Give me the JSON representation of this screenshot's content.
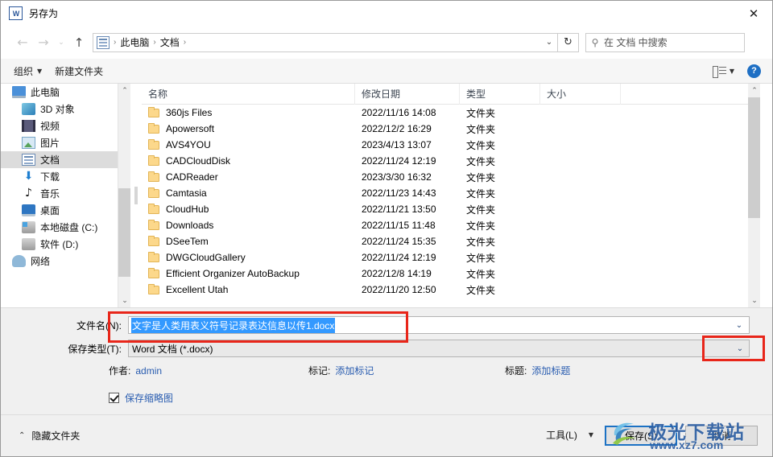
{
  "window": {
    "title": "另存为",
    "app_icon": "W",
    "close_label": "✕"
  },
  "navbar": {
    "back_icon": "←",
    "forward_icon": "→",
    "recent_icon": "⌄",
    "up_icon": "↑",
    "breadcrumbs": [
      "此电脑",
      "文档"
    ],
    "separator": "›",
    "dropdown_icon": "⌄",
    "refresh_icon": "↻",
    "search_icon": "🔍",
    "search_placeholder": "在 文档 中搜索"
  },
  "toolbar": {
    "organize_label": "组织",
    "organize_caret": "▼",
    "new_folder_label": "新建文件夹",
    "view_caret": "▼",
    "help_label": "?"
  },
  "sidebar": {
    "items": [
      {
        "label": "此电脑",
        "icon": "pc-icon",
        "cls": "ic-pc",
        "root": true,
        "selected": false
      },
      {
        "label": "3D 对象",
        "icon": "3d-objects-icon",
        "cls": "ic-3d",
        "root": false,
        "selected": false
      },
      {
        "label": "视频",
        "icon": "videos-icon",
        "cls": "ic-video",
        "root": false,
        "selected": false
      },
      {
        "label": "图片",
        "icon": "pictures-icon",
        "cls": "ic-pic",
        "root": false,
        "selected": false
      },
      {
        "label": "文档",
        "icon": "documents-icon",
        "cls": "ic-doc",
        "root": false,
        "selected": true
      },
      {
        "label": "下载",
        "icon": "downloads-icon",
        "cls": "ic-dl",
        "glyph": "⬇",
        "root": false,
        "selected": false
      },
      {
        "label": "音乐",
        "icon": "music-icon",
        "cls": "ic-music",
        "glyph": "♪",
        "root": false,
        "selected": false
      },
      {
        "label": "桌面",
        "icon": "desktop-icon",
        "cls": "ic-desk",
        "root": false,
        "selected": false
      },
      {
        "label": "本地磁盘 (C:)",
        "icon": "local-disk-c-icon",
        "cls": "ic-drive sys",
        "root": false,
        "selected": false
      },
      {
        "label": "软件 (D:)",
        "icon": "drive-d-icon",
        "cls": "ic-drive",
        "root": false,
        "selected": false
      },
      {
        "label": "网络",
        "icon": "network-icon",
        "cls": "ic-net",
        "root": true,
        "selected": false
      }
    ],
    "scroll_up_icon": "⌃",
    "scroll_down_icon": "⌄"
  },
  "filelist": {
    "columns": [
      "名称",
      "修改日期",
      "类型",
      "大小"
    ],
    "rows": [
      {
        "name": "360js Files",
        "date": "2022/11/16 14:08",
        "type": "文件夹",
        "size": ""
      },
      {
        "name": "Apowersoft",
        "date": "2022/12/2 16:29",
        "type": "文件夹",
        "size": ""
      },
      {
        "name": "AVS4YOU",
        "date": "2023/4/13 13:07",
        "type": "文件夹",
        "size": ""
      },
      {
        "name": "CADCloudDisk",
        "date": "2022/11/24 12:19",
        "type": "文件夹",
        "size": ""
      },
      {
        "name": "CADReader",
        "date": "2023/3/30 16:32",
        "type": "文件夹",
        "size": ""
      },
      {
        "name": "Camtasia",
        "date": "2022/11/23 14:43",
        "type": "文件夹",
        "size": ""
      },
      {
        "name": "CloudHub",
        "date": "2022/11/21 13:50",
        "type": "文件夹",
        "size": ""
      },
      {
        "name": "Downloads",
        "date": "2022/11/15 11:48",
        "type": "文件夹",
        "size": ""
      },
      {
        "name": "DSeeTem",
        "date": "2022/11/24 15:35",
        "type": "文件夹",
        "size": ""
      },
      {
        "name": "DWGCloudGallery",
        "date": "2022/11/24 12:19",
        "type": "文件夹",
        "size": ""
      },
      {
        "name": "Efficient Organizer AutoBackup",
        "date": "2022/12/8 14:19",
        "type": "文件夹",
        "size": ""
      },
      {
        "name": "Excellent Utah",
        "date": "2022/11/20 12:50",
        "type": "文件夹",
        "size": ""
      }
    ],
    "scroll_up_icon": "⌃",
    "scroll_down_icon": "⌄"
  },
  "form": {
    "filename_label": "文件名(N):",
    "filename_value": "文字是人类用表义符号记录表达信息以传1.docx",
    "filename_caret": "⌄",
    "savetype_label": "保存类型(T):",
    "savetype_value": "Word 文档 (*.docx)",
    "savetype_caret": "⌄",
    "author_key": "作者:",
    "author_value": "admin",
    "tags_key": "标记:",
    "tags_value": "添加标记",
    "title_key": "标题:",
    "title_value": "添加标题",
    "thumbnail_label": "保存缩略图",
    "thumbnail_checked": true
  },
  "footer": {
    "hide_folders_label": "隐藏文件夹",
    "hide_folders_caret": "⌃",
    "tools_label": "工具(L)",
    "tools_caret": "▼",
    "save_label": "保存(S)",
    "cancel_label": "取消"
  },
  "watermark": {
    "brand_cn": "极光下载站",
    "url": "www.xz7.com"
  },
  "colors": {
    "accent_blue": "#1c72c4",
    "selection_blue": "#3399ff",
    "link_blue": "#2a5db0",
    "annotation_red": "#e8261a",
    "folder_yellow": "#fcd88b",
    "watermark_blue": "#2e5fa3"
  }
}
